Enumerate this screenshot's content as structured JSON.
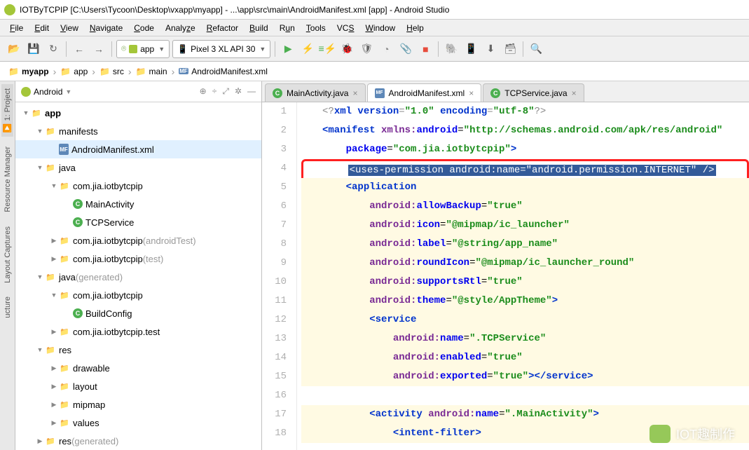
{
  "window": {
    "title": "IOTByTCPIP [C:\\Users\\Tycoon\\Desktop\\vxapp\\myapp] - ...\\app\\src\\main\\AndroidManifest.xml [app] - Android Studio"
  },
  "menu": {
    "file": "File",
    "edit": "Edit",
    "view": "View",
    "navigate": "Navigate",
    "code": "Code",
    "analyze": "Analyze",
    "refactor": "Refactor",
    "build": "Build",
    "run": "Run",
    "tools": "Tools",
    "vcs": "VCS",
    "window": "Window",
    "help": "Help"
  },
  "toolbar": {
    "module": "app",
    "device": "Pixel 3 XL API 30"
  },
  "breadcrumbs": [
    "myapp",
    "app",
    "src",
    "main",
    "AndroidManifest.xml"
  ],
  "project": {
    "dropdown": "Android",
    "tree": [
      {
        "d": 0,
        "arr": "▼",
        "ic": "folder",
        "label": "app",
        "bold": true
      },
      {
        "d": 1,
        "arr": "▼",
        "ic": "folder",
        "label": "manifests"
      },
      {
        "d": 2,
        "arr": "",
        "ic": "xml",
        "label": "AndroidManifest.xml",
        "sel": true
      },
      {
        "d": 1,
        "arr": "▼",
        "ic": "folder",
        "label": "java"
      },
      {
        "d": 2,
        "arr": "▼",
        "ic": "pkg",
        "label": "com.jia.iotbytcpip"
      },
      {
        "d": 3,
        "arr": "",
        "ic": "cls",
        "label": "MainActivity"
      },
      {
        "d": 3,
        "arr": "",
        "ic": "cls",
        "label": "TCPService"
      },
      {
        "d": 2,
        "arr": "▶",
        "ic": "pkg",
        "label": "com.jia.iotbytcpip",
        "suffix": "(androidTest)"
      },
      {
        "d": 2,
        "arr": "▶",
        "ic": "pkg",
        "label": "com.jia.iotbytcpip",
        "suffix": "(test)"
      },
      {
        "d": 1,
        "arr": "▼",
        "ic": "folder",
        "label": "java",
        "suffix": "(generated)"
      },
      {
        "d": 2,
        "arr": "▼",
        "ic": "pkg",
        "label": "com.jia.iotbytcpip"
      },
      {
        "d": 3,
        "arr": "",
        "ic": "cls",
        "label": "BuildConfig"
      },
      {
        "d": 2,
        "arr": "▶",
        "ic": "pkg",
        "label": "com.jia.iotbytcpip.test"
      },
      {
        "d": 1,
        "arr": "▼",
        "ic": "folder",
        "label": "res"
      },
      {
        "d": 2,
        "arr": "▶",
        "ic": "folder",
        "label": "drawable"
      },
      {
        "d": 2,
        "arr": "▶",
        "ic": "folder",
        "label": "layout"
      },
      {
        "d": 2,
        "arr": "▶",
        "ic": "folder",
        "label": "mipmap"
      },
      {
        "d": 2,
        "arr": "▶",
        "ic": "folder",
        "label": "values"
      },
      {
        "d": 1,
        "arr": "▶",
        "ic": "folder",
        "label": "res",
        "suffix": "(generated)"
      }
    ]
  },
  "editor": {
    "tabs": [
      {
        "icon": "c",
        "label": "MainActivity.java",
        "active": false
      },
      {
        "icon": "m",
        "label": "AndroidManifest.xml",
        "active": true
      },
      {
        "icon": "c",
        "label": "TCPService.java",
        "active": false
      }
    ],
    "lines": [
      {
        "n": 1,
        "html": "<span class='pi'>&lt;?</span><span class='tag'>xml version</span><span class='pi'>=</span><span class='str'>\"1.0\"</span> <span class='tag'>encoding</span><span class='pi'>=</span><span class='str'>\"utf-8\"</span><span class='pi'>?&gt;</span>"
      },
      {
        "n": 2,
        "html": "<span class='tag'>&lt;manifest</span> <span class='ns'>xmlns:</span><span class='attr'>android</span>=<span class='str'>\"http://schemas.android.com/apk/res/android\"</span>"
      },
      {
        "n": 3,
        "html": "    <span class='attr'>package</span>=<span class='str'>\"com.jia.iotbytcpip\"</span><span class='tag'>&gt;</span>"
      },
      {
        "n": 4,
        "hl": true,
        "html": "    <span class='seltext'>&lt;uses-permission android:name=\"android.permission.INTERNET\" /&gt;</span>"
      },
      {
        "n": 5,
        "bg": true,
        "html": "    <span class='tag'>&lt;application</span>"
      },
      {
        "n": 6,
        "bg": true,
        "html": "        <span class='ns'>android:</span><span class='attr'>allowBackup</span>=<span class='str'>\"true\"</span>"
      },
      {
        "n": 7,
        "bg": true,
        "html": "        <span class='ns'>android:</span><span class='attr'>icon</span>=<span class='str'>\"@mipmap/ic_launcher\"</span>"
      },
      {
        "n": 8,
        "bg": true,
        "html": "        <span class='ns'>android:</span><span class='attr'>label</span>=<span class='str'>\"@string/app_name\"</span>"
      },
      {
        "n": 9,
        "bg": true,
        "html": "        <span class='ns'>android:</span><span class='attr'>roundIcon</span>=<span class='str'>\"@mipmap/ic_launcher_round\"</span>"
      },
      {
        "n": 10,
        "bg": true,
        "html": "        <span class='ns'>android:</span><span class='attr'>supportsRtl</span>=<span class='str'>\"true\"</span>"
      },
      {
        "n": 11,
        "bg": true,
        "html": "        <span class='ns'>android:</span><span class='attr'>theme</span>=<span class='str'>\"@style/AppTheme\"</span><span class='tag'>&gt;</span>"
      },
      {
        "n": 12,
        "bg": true,
        "html": "        <span class='tag'>&lt;service</span>"
      },
      {
        "n": 13,
        "bg": true,
        "html": "            <span class='ns'>android:</span><span class='attr'>name</span>=<span class='str'>\".TCPService\"</span>"
      },
      {
        "n": 14,
        "bg": true,
        "html": "            <span class='ns'>android:</span><span class='attr'>enabled</span>=<span class='str'>\"true\"</span>"
      },
      {
        "n": 15,
        "bg": true,
        "html": "            <span class='ns'>android:</span><span class='attr'>exported</span>=<span class='str'>\"true\"</span><span class='tag'>&gt;&lt;/service&gt;</span>"
      },
      {
        "n": 16,
        "bg": true,
        "html": ""
      },
      {
        "n": 17,
        "bg": true,
        "html": "        <span class='tag'>&lt;activity</span> <span class='ns'>android:</span><span class='attr'>name</span>=<span class='str'>\".MainActivity\"</span><span class='tag'>&gt;</span>"
      },
      {
        "n": 18,
        "bg": true,
        "html": "            <span class='tag'>&lt;intent-filter&gt;</span>"
      }
    ]
  },
  "watermark": "IOT趣制作"
}
